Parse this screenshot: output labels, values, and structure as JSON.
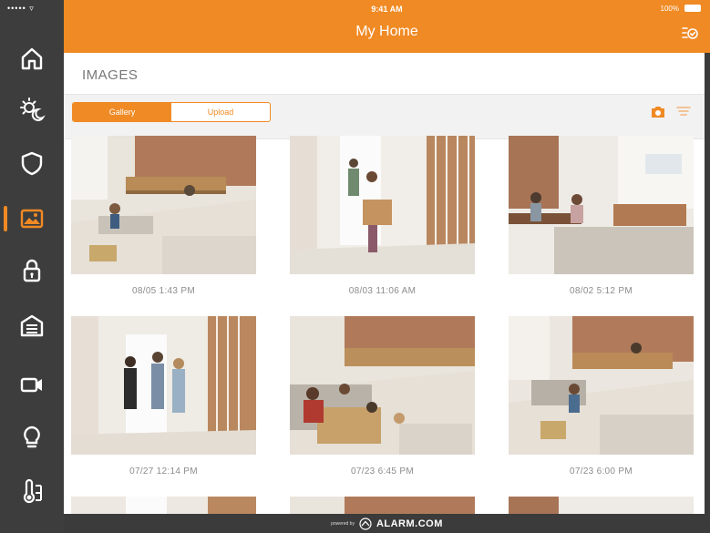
{
  "status": {
    "signal": "••••• ▿",
    "time": "9:41 AM",
    "battery": "100%"
  },
  "header": {
    "title": "My Home"
  },
  "sidebar": {
    "items": [
      {
        "icon": "home-icon"
      },
      {
        "icon": "sun-moon-icon"
      },
      {
        "icon": "shield-icon"
      },
      {
        "icon": "image-icon",
        "active": true
      },
      {
        "icon": "lock-icon"
      },
      {
        "icon": "garage-icon"
      },
      {
        "icon": "video-camera-icon"
      },
      {
        "icon": "lightbulb-icon"
      },
      {
        "icon": "thermostat-icon"
      }
    ]
  },
  "page": {
    "title": "IMAGES"
  },
  "toolbar": {
    "tabs": [
      "Gallery",
      "Upload"
    ],
    "active_tab": "Gallery"
  },
  "images": [
    {
      "caption": "08/05 1:43 PM"
    },
    {
      "caption": "08/03 11:06 AM"
    },
    {
      "caption": "08/02 5:12 PM"
    },
    {
      "caption": "07/27 12:14 PM"
    },
    {
      "caption": "07/23 6:45 PM"
    },
    {
      "caption": "07/23 6:00 PM"
    }
  ],
  "footer": {
    "powered_by": "powered by",
    "brand": "ALARM.COM"
  },
  "colors": {
    "accent": "#f08a24",
    "sidebar": "#3d3d3d"
  }
}
